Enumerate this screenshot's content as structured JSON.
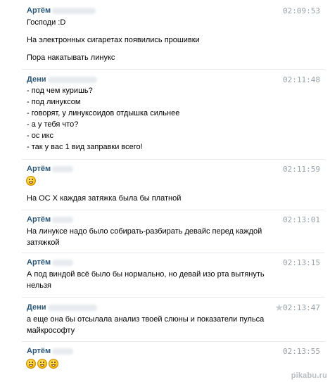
{
  "messages": [
    {
      "author": "Артём",
      "time": "02:09:53",
      "lines": [
        "Господи :D",
        "На электронных сигаретах появились прошивки",
        "Пора накатывать линукс"
      ]
    },
    {
      "author": "Дени",
      "time": "02:11:48",
      "lines": [
        "- под чем куришь?",
        "- под линуксом",
        "- говорят, у линуксоидов отдышка сильнее",
        "- а у тебя что?",
        "- ос икс",
        "- так у вас 1 вид заправки всего!"
      ]
    },
    {
      "author": "Артём",
      "time": "02:11:59",
      "emoji_icons": [
        "grinning-emoji-icon"
      ],
      "lines": [
        "На ОС Х каждая затяжка была бы платной"
      ]
    },
    {
      "author": "Артём",
      "time": "02:13:01",
      "lines": [
        "На линуксе надо было собирать-разбирать девайс перед каждой",
        "затяжкой"
      ]
    },
    {
      "author": "Артём",
      "time": "02:13:15",
      "lines": [
        "А под виндой всё было бы нормально, но девай изо рта вытянуть",
        "нельзя"
      ]
    },
    {
      "author": "Дени",
      "time": "02:13:47",
      "star_icon": "star-icon",
      "lines": [
        "а еще она бы отсылала анализ твоей слюны и показатели пульса",
        "майкрософту"
      ]
    },
    {
      "author": "Артём",
      "time": "02:13:55",
      "emoji_icons": [
        "grinning-emoji-icon",
        "grinning-emoji-icon",
        "grinning-emoji-icon"
      ]
    }
  ],
  "watermark": "pikabu.ru",
  "colors": {
    "author": "#2b587a",
    "time": "#98a0a8",
    "separator": "#e4e8ed"
  }
}
